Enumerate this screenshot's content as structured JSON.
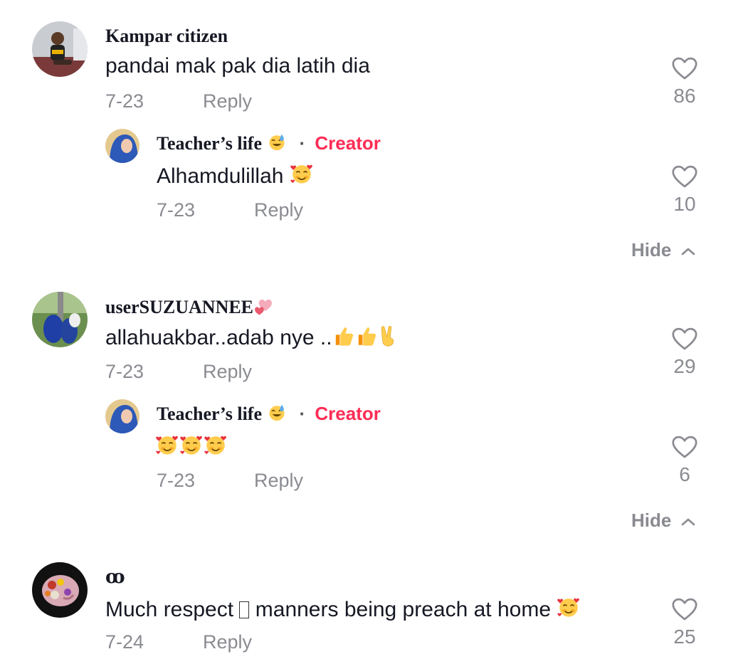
{
  "comments": [
    {
      "username": "Kampar citizen",
      "text": "pandai mak pak dia latih dia",
      "date": "7-23",
      "reply_label": "Reply",
      "likes": "86",
      "avatar_icon": "child-photo-avatar",
      "reply": {
        "username": "Teacher’s life",
        "username_emoji": "sweat-smile-emoji",
        "separator": "·",
        "badge": "Creator",
        "text": "Alhamdulillah",
        "text_emoji": "smiling-face-with-hearts-emoji",
        "date": "7-23",
        "reply_label": "Reply",
        "likes": "10",
        "avatar_icon": "hijab-woman-avatar"
      },
      "hide_label": "Hide"
    },
    {
      "username": "userSUZUANNEE",
      "username_emoji": "two-hearts-emoji",
      "text": "allahuakbar..adab nye ..",
      "text_emoji": "thumbs-up-thumbs-up-victory-emoji",
      "date": "7-23",
      "reply_label": "Reply",
      "likes": "29",
      "avatar_icon": "outdoor-group-avatar",
      "reply": {
        "username": "Teacher’s life",
        "username_emoji": "sweat-smile-emoji",
        "separator": "·",
        "badge": "Creator",
        "text": "",
        "text_emoji": "smiling-face-with-hearts-x3-emoji",
        "date": "7-23",
        "reply_label": "Reply",
        "likes": "6",
        "avatar_icon": "hijab-woman-avatar"
      },
      "hide_label": "Hide"
    },
    {
      "username": "ꝏ",
      "text_before": "Much respect",
      "text_after": "manners being preach at home",
      "text_emoji": "smiling-face-with-hearts-emoji",
      "date": "7-24",
      "reply_label": "Reply",
      "likes": "25",
      "avatar_icon": "floral-brain-avatar"
    }
  ],
  "colors": {
    "creator_badge": "#fe2c55",
    "secondary_text": "#8a8b91",
    "primary_text": "#161823"
  }
}
